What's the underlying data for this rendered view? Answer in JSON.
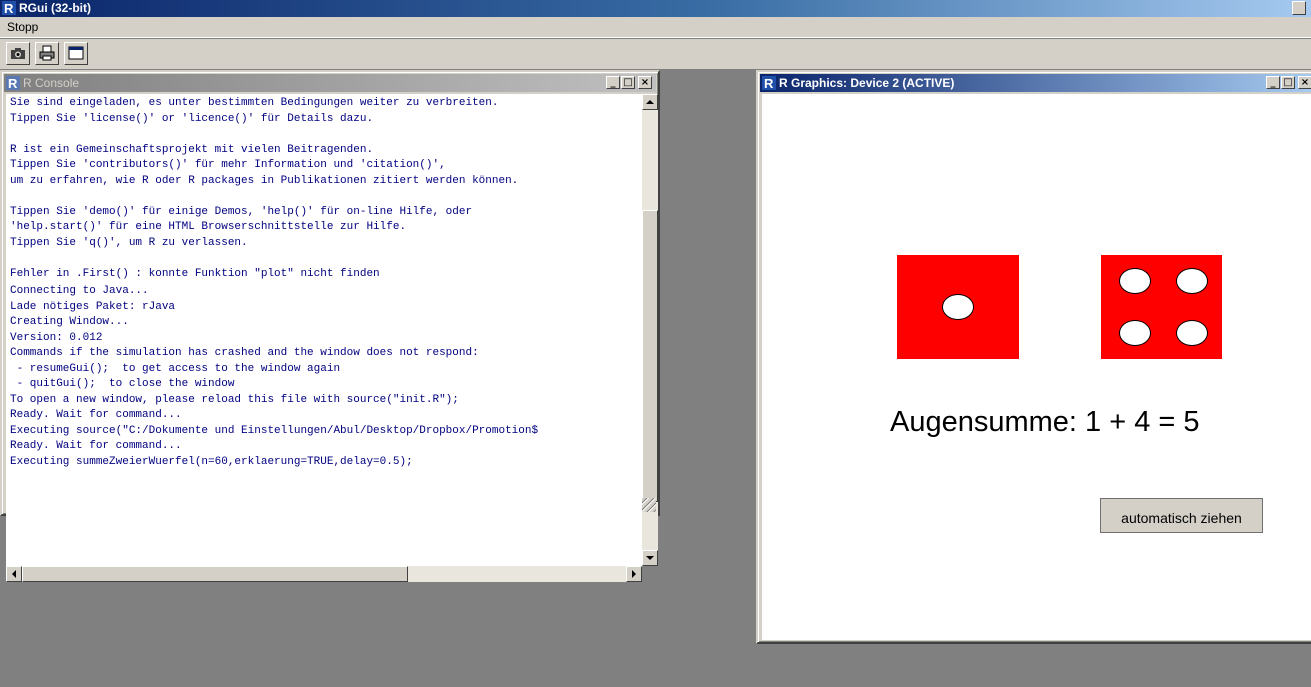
{
  "app": {
    "title": "RGui (32-bit)",
    "menu": [
      "Stopp"
    ],
    "toolbar": [
      "camera-icon",
      "print-icon",
      "console-icon"
    ]
  },
  "console": {
    "title": "R Console",
    "controls": [
      "_",
      "□",
      "×"
    ],
    "text": "Sie sind eingeladen, es unter bestimmten Bedingungen weiter zu verbreiten.\nTippen Sie 'license()' or 'licence()' für Details dazu.\n\nR ist ein Gemeinschaftsprojekt mit vielen Beitragenden.\nTippen Sie 'contributors()' für mehr Information und 'citation()',\num zu erfahren, wie R oder R packages in Publikationen zitiert werden können.\n\nTippen Sie 'demo()' für einige Demos, 'help()' für on-line Hilfe, oder\n'help.start()' für eine HTML Browserschnittstelle zur Hilfe.\nTippen Sie 'q()', um R zu verlassen.\n\nFehler in .First() : konnte Funktion \"plot\" nicht finden",
    "output": "Connecting to Java...\nLade nötiges Paket: rJava\nCreating Window...\nVersion: 0.012\nCommands if the simulation has crashed and the window does not respond:\n - resumeGui();  to get access to the window again\n - quitGui();  to close the window\nTo open a new window, please reload this file with source(\"init.R\");\nReady. Wait for command...\nExecuting source(\"C:/Dokumente und Einstellungen/Abul/Desktop/Dropbox/Promotion$\nReady. Wait for command...\nExecuting summeZweierWuerfel(n=60,erklaerung=TRUE,delay=0.5);"
  },
  "graphics": {
    "title": "R Graphics: Device 2 (ACTIVE)",
    "controls": [
      "_",
      "□",
      "×"
    ],
    "die1": 1,
    "die2": 4,
    "die_color": "#ff0000",
    "sum_label": "Augensumme: 1 + 4 = 5",
    "button_label": "automatisch ziehen"
  },
  "colors": {
    "desktop": "#808080",
    "chrome": "#d4d0c8",
    "active_title": "#0a246a",
    "console_text": "#000080"
  }
}
